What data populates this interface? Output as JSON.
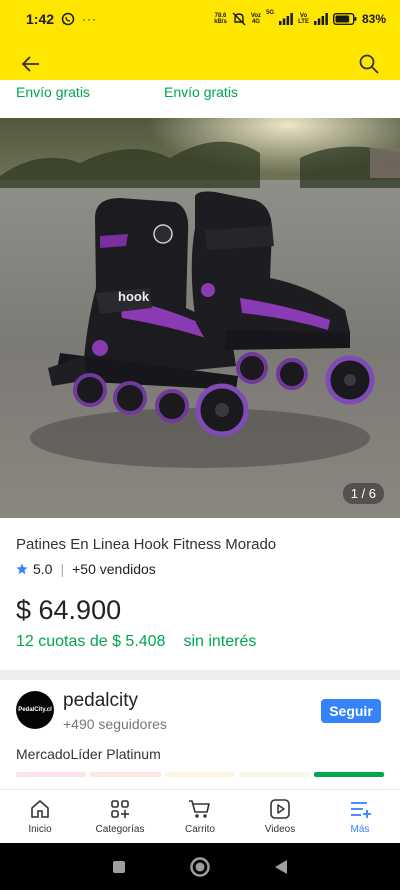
{
  "status_bar": {
    "time": "1:42",
    "net_speed_value": "78.6",
    "net_speed_unit": "kB/s",
    "sim1_top": "Voz",
    "sim1_bottom": "4G",
    "sim2_top": "Vo",
    "sim2_bottom": "LTE",
    "five_g": "5G",
    "battery": "83%",
    "battery_level": 0.83
  },
  "shipping": {
    "left": "Envío gratis",
    "right": "Envío gratis"
  },
  "product": {
    "image_counter": "1 / 6",
    "brand_on_skate": "hook",
    "title": "Patines En Linea Hook Fitness Morado",
    "rating": "5.0",
    "sold": "+50 vendidos",
    "price": "$ 64.900",
    "installments": "12 cuotas de $ 5.408",
    "no_interest": "sin interés"
  },
  "seller": {
    "logo_text": "PedalCity.cl",
    "name": "pedalcity",
    "followers": "+490 seguidores",
    "follow_label": "Seguir",
    "level": "MercadoLíder Platinum",
    "thermometer_colors": [
      "#fde3e5",
      "#fde7e1",
      "#fef6e1",
      "#f3f8e3",
      "#00a650"
    ]
  },
  "bottom_nav": [
    {
      "label": "Inicio",
      "icon": "home-icon"
    },
    {
      "label": "Categorías",
      "icon": "categories-icon"
    },
    {
      "label": "Carrito",
      "icon": "cart-icon"
    },
    {
      "label": "Videos",
      "icon": "video-icon"
    },
    {
      "label": "Más",
      "icon": "menu-more-icon"
    }
  ],
  "colors": {
    "brand_yellow": "#ffe600",
    "green": "#00a650",
    "blue": "#3483fa"
  }
}
